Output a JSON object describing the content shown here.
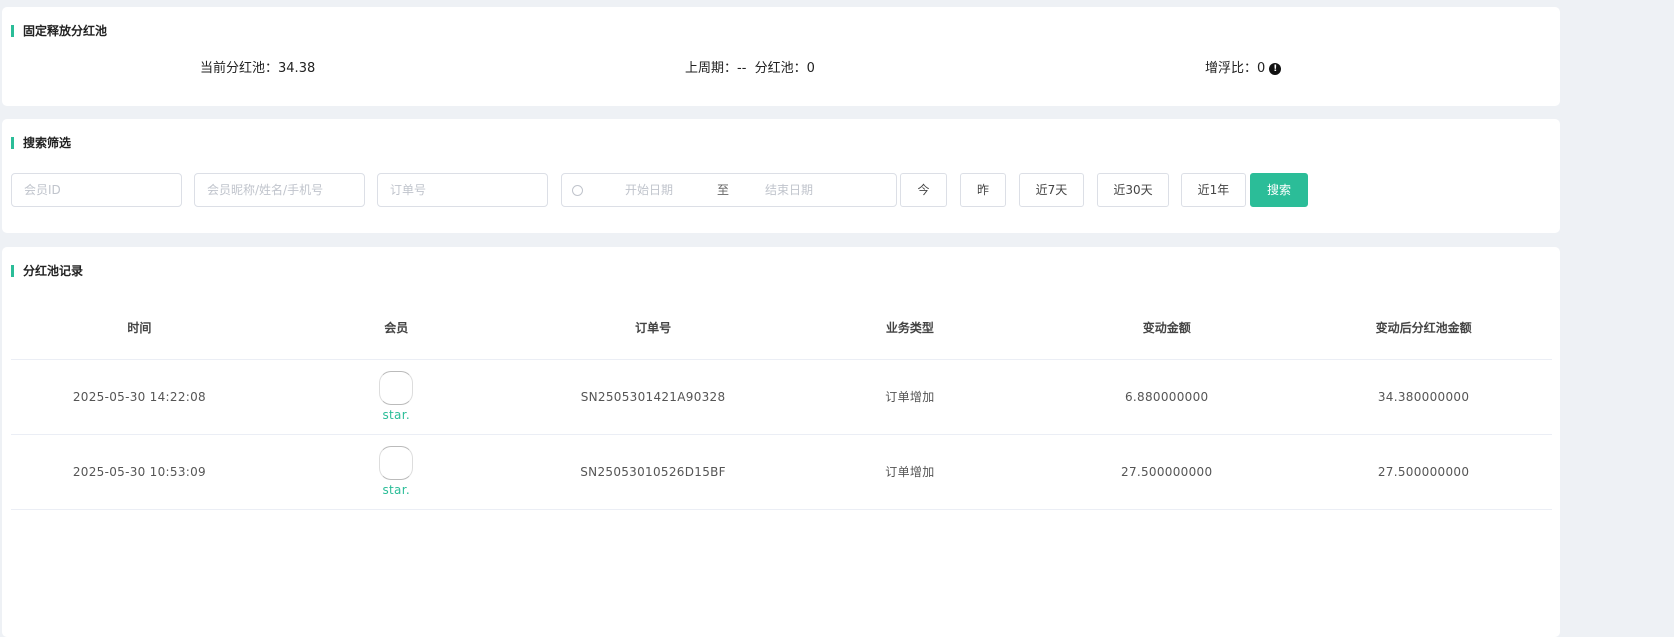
{
  "pool": {
    "title": "固定释放分红池",
    "current_label": "当前分红池：",
    "current_value": "34.38",
    "last_week_label": "上周期：--  分红池：",
    "last_week_value": "0",
    "ratio_label": "增浮比：",
    "ratio_value": "0",
    "info_icon": "!"
  },
  "filter": {
    "title": "搜索筛选",
    "member_id_placeholder": "会员ID",
    "member_name_placeholder": "会员昵称/姓名/手机号",
    "order_placeholder": "订单号",
    "start_placeholder": "开始日期",
    "range_sep": "至",
    "end_placeholder": "结束日期",
    "buttons": [
      "今",
      "昨",
      "近7天",
      "近30天",
      "近1年"
    ],
    "search": "搜索"
  },
  "records": {
    "title": "分红池记录",
    "columns": [
      "时间",
      "会员",
      "订单号",
      "业务类型",
      "变动金额",
      "变动后分红池金额"
    ],
    "rows": [
      {
        "time": "2025-05-30 14:22:08",
        "member": "star.",
        "order": "SN2505301421A90328",
        "type": "订单增加",
        "change": "6.880000000",
        "after": "34.380000000"
      },
      {
        "time": "2025-05-30 10:53:09",
        "member": "star.",
        "order": "SN25053010526D15BF",
        "type": "订单增加",
        "change": "27.500000000",
        "after": "27.500000000"
      }
    ]
  },
  "colors": {
    "accent": "#2bbd98"
  }
}
